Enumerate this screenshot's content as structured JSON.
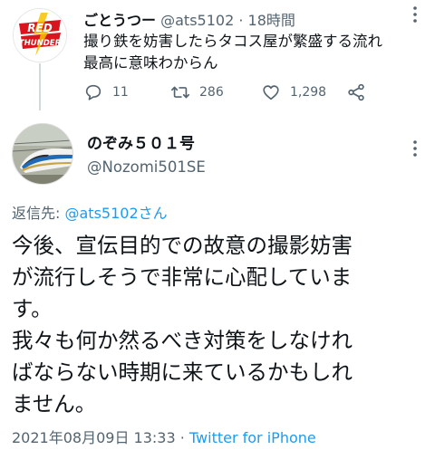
{
  "tweet1": {
    "avatar_text": [
      "RED",
      "THUNDER"
    ],
    "display_name": "ごとうつー",
    "handle": "@ats5102",
    "separator": "·",
    "time": "18時間",
    "text_line1": "撮り鉄を妨害したらタコス屋が繁盛する流れ",
    "text_line2": "最高に意味わからん",
    "actions": {
      "reply_count": "11",
      "retweet_count": "286",
      "like_count": "1,298"
    },
    "icons": [
      "more-icon",
      "reply-icon",
      "retweet-icon",
      "like-icon",
      "share-icon"
    ]
  },
  "tweet2": {
    "display_name": "のぞみ５０１号",
    "handle": "@Nozomi501SE",
    "reply_to_label": "返信先:",
    "reply_to_user": "@ats5102さん",
    "text_lines": [
      "今後、宣伝目的での故意の撮影妨害",
      "が流行しそうで非常に心配していま",
      "す。",
      "我々も何か然るべき対策をしなけれ",
      "ばならない時期に来ているかもしれ",
      "ません。"
    ],
    "date": "2021年08月09日 13:33",
    "separator": "·",
    "source": "Twitter for iPhone"
  },
  "colors": {
    "link": "#1d9bf0",
    "secondary_text": "#536471",
    "primary_text": "#0f1419",
    "thread_line": "#cfd9de"
  }
}
